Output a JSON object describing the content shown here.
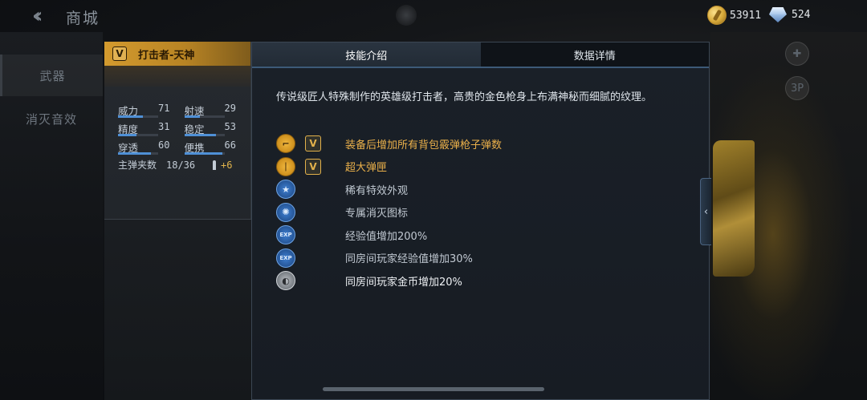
{
  "header": {
    "title": "商城",
    "coins": "53911",
    "gems": "524"
  },
  "left_nav": {
    "items": [
      {
        "label": "武器"
      },
      {
        "label": "消灭音效"
      }
    ]
  },
  "right_hud": {
    "view_label": "3P"
  },
  "weapon": {
    "badge": "V",
    "name": "打击者-天神",
    "stats": [
      {
        "label": "威力",
        "value": "71",
        "fill": 0.62
      },
      {
        "label": "射速",
        "value": "29",
        "fill": 0.38
      },
      {
        "label": "精度",
        "value": "31",
        "fill": 0.45
      },
      {
        "label": "稳定",
        "value": "53",
        "fill": 0.78
      },
      {
        "label": "穿透",
        "value": "60",
        "fill": 0.82
      },
      {
        "label": "便携",
        "value": "66",
        "fill": 0.95
      }
    ],
    "magazine": {
      "label": "主弹夹数",
      "value": "18/36",
      "bonus": "+6"
    }
  },
  "tabs": [
    {
      "label": "技能介绍",
      "active": true
    },
    {
      "label": "数据详情",
      "active": false
    }
  ],
  "description": "传说级匠人特殊制作的英雄级打击者，高贵的金色枪身上布满神秘而细腻的纹理。",
  "features": [
    {
      "icon": "rifle-icon",
      "icon_style": "gold",
      "has_v": true,
      "text": "装备后增加所有背包霰弹枪子弹数",
      "color": "gold"
    },
    {
      "icon": "magazine-icon",
      "icon_style": "gold",
      "has_v": true,
      "text": "超大弹匣",
      "color": "gold"
    },
    {
      "icon": "star-icon",
      "icon_style": "blue",
      "has_v": false,
      "text": "稀有特效外观",
      "color": "grey"
    },
    {
      "icon": "kill-icon",
      "icon_style": "blue",
      "has_v": false,
      "text": "专属消灭图标",
      "color": "grey"
    },
    {
      "icon": "exp-icon",
      "icon_style": "blue",
      "has_v": false,
      "text": "经验值增加200%",
      "color": "grey"
    },
    {
      "icon": "room-exp-icon",
      "icon_style": "blue",
      "has_v": false,
      "text": "同房间玩家经验值增加30%",
      "color": "grey"
    },
    {
      "icon": "room-coin-icon",
      "icon_style": "grey",
      "has_v": false,
      "text": "同房间玩家金币增加20%",
      "color": "white"
    }
  ],
  "icon_glyphs": {
    "rifle-icon": "⌐",
    "magazine-icon": "❘",
    "star-icon": "★",
    "kill-icon": "✺",
    "exp-icon": "EXP",
    "room-exp-icon": "EXP",
    "room-coin-icon": "◐"
  },
  "colors": {
    "gold_accent": "#eab04a",
    "header_gold": "#d39a2e",
    "stat_bar": "#4f90d6"
  }
}
